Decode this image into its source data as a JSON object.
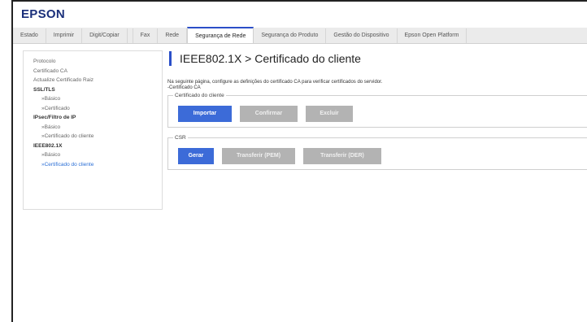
{
  "brand": {
    "logo_text": "EPSON"
  },
  "tabs": [
    {
      "label": "Estado"
    },
    {
      "label": "Imprimir"
    },
    {
      "label": "Digit/Copiar"
    },
    {
      "label": "Fax"
    },
    {
      "label": "Rede"
    },
    {
      "label": "Segurança de Rede",
      "active": true
    },
    {
      "label": "Segurança do Produto"
    },
    {
      "label": "Gestão do Dispositivo"
    },
    {
      "label": "Epson Open Platform"
    }
  ],
  "sidebar": {
    "items": [
      {
        "label": "Protocolo",
        "kind": "link"
      },
      {
        "label": "Certificado CA",
        "kind": "link"
      },
      {
        "label": "Actualize Certificado Raiz",
        "kind": "link"
      },
      {
        "label": "SSL/TLS",
        "kind": "section"
      },
      {
        "label": "»Básico",
        "kind": "sub"
      },
      {
        "label": "»Certificado",
        "kind": "sub"
      },
      {
        "label": "IPsec/Filtro de IP",
        "kind": "section"
      },
      {
        "label": "»Básico",
        "kind": "sub"
      },
      {
        "label": "»Certificado do cliente",
        "kind": "sub"
      },
      {
        "label": "IEEE802.1X",
        "kind": "section"
      },
      {
        "label": "»Básico",
        "kind": "sub"
      },
      {
        "label": "»Certificado do cliente",
        "kind": "sub-current"
      }
    ]
  },
  "main": {
    "title": "IEEE802.1X > Certificado do cliente",
    "description_line1": "Na seguinte página, configure as definições do certificado CA para verificar certificados do servidor.",
    "description_line2": "-Certificado CA",
    "client_cert": {
      "legend": "Certificado do cliente",
      "import_label": "Importar",
      "confirm_label": "Confirmar",
      "delete_label": "Excluir"
    },
    "csr": {
      "legend": "CSR",
      "generate_label": "Gerar",
      "download_pem_label": "Transferir (PEM)",
      "download_der_label": "Transferir (DER)"
    }
  },
  "colors": {
    "accent": "#2b4fc8",
    "button_primary": "#3c6bd8",
    "button_disabled": "#b3b3b3",
    "link_current": "#2b6fd6",
    "logo": "#1a2f7a"
  }
}
